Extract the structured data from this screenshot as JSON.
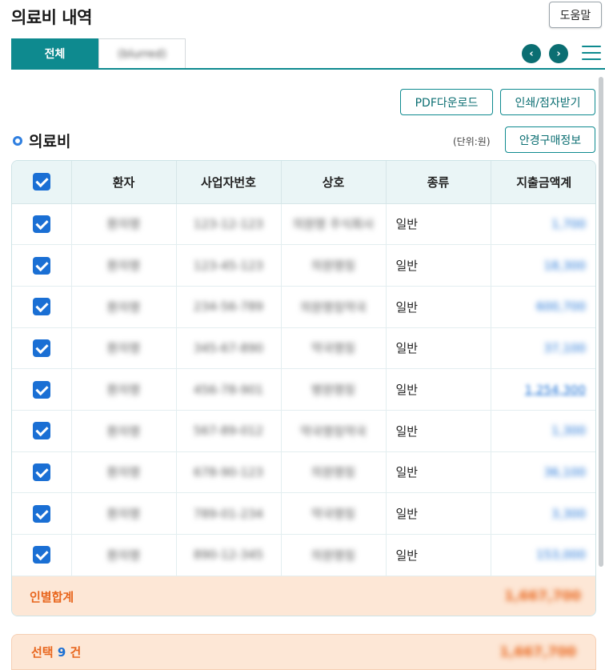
{
  "header": {
    "title": "의료비 내역",
    "help_label": "도움말"
  },
  "tabs": [
    {
      "label": "전체",
      "active": true
    },
    {
      "label": "(blurred)",
      "active": false
    }
  ],
  "nav": {
    "prev_icon": "chevron-left-icon",
    "next_icon": "chevron-right-icon",
    "menu_icon": "hamburger-menu-icon"
  },
  "actions": {
    "pdf_download": "PDF다운로드",
    "print_braille": "인쇄/점자받기",
    "glasses_info": "안경구매정보"
  },
  "section": {
    "title": "의료비",
    "unit": "(단위:원)"
  },
  "table": {
    "headers": [
      "환자",
      "사업자번호",
      "상호",
      "종류",
      "지출금액계"
    ],
    "rows": [
      {
        "patient": "환자명",
        "biz_no": "123-12-123",
        "name": "의원명 주식회사",
        "kind": "일반",
        "amount": "1,700"
      },
      {
        "patient": "환자명",
        "biz_no": "123-45-123",
        "name": "의원명칭",
        "kind": "일반",
        "amount": "18,300"
      },
      {
        "patient": "환자명",
        "biz_no": "234-56-789",
        "name": "의원명칭약국",
        "kind": "일반",
        "amount": "600,700"
      },
      {
        "patient": "환자명",
        "biz_no": "345-67-890",
        "name": "약국명칭",
        "kind": "일반",
        "amount": "37,100"
      },
      {
        "patient": "환자명",
        "biz_no": "456-78-901",
        "name": "병원명칭",
        "kind": "일반",
        "amount": "1,254,300"
      },
      {
        "patient": "환자명",
        "biz_no": "567-89-012",
        "name": "약국명칭약국",
        "kind": "일반",
        "amount": "1,300"
      },
      {
        "patient": "환자명",
        "biz_no": "678-90-123",
        "name": "의원명칭",
        "kind": "일반",
        "amount": "36,100"
      },
      {
        "patient": "환자명",
        "biz_no": "789-01-234",
        "name": "약국명칭",
        "kind": "일반",
        "amount": "3,300"
      },
      {
        "patient": "환자명",
        "biz_no": "890-12-345",
        "name": "의원명칭",
        "kind": "일반",
        "amount": "153,000"
      }
    ],
    "sum_label": "인별합계",
    "sum_value": "1,667,700"
  },
  "selection": {
    "prefix": "선택",
    "count": "9",
    "suffix": "건",
    "total": "1,667,700"
  },
  "colors": {
    "teal": "#0e8a8f",
    "blue": "#1a6fd4",
    "orange": "#e8651c",
    "sum_bg": "#fde7d6"
  }
}
